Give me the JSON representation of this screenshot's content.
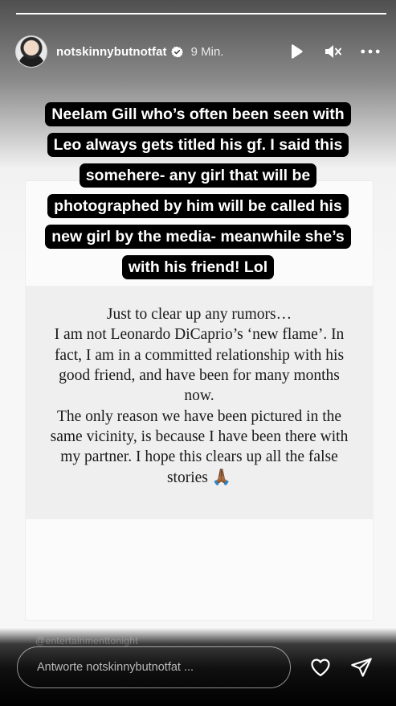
{
  "story": {
    "progress_fraction": 1.0,
    "username": "notskinnybutnotfat",
    "verified": true,
    "time_ago": "9 Min."
  },
  "controls": {
    "icons": [
      "play-icon",
      "muted-speaker-icon",
      "more-icon"
    ]
  },
  "caption_lines": [
    "Neelam Gill who’s often been seen with",
    "Leo always gets titled his gf. I said this",
    "somehere- any girl that will be",
    "photographed by him will be called his",
    "new girl by the media- meanwhile she’s",
    "with his friend! Lol"
  ],
  "statement": {
    "text": "Just to clear up any rumors…\nI am not Leonardo DiCaprio’s ‘new flame’. In fact, I am in a committed relationship with his good friend, and have been for many months now.\nThe only reason we have been pictured in the same vicinity, is because I have been there with my partner. I hope this clears up all the false stories 🙏🏾"
  },
  "watermark": "@entertainmenttonight",
  "reply": {
    "placeholder": "Antworte notskinnybutnotfat ..."
  },
  "colors": {
    "accent_white": "#ffffff",
    "sticker_bg": "#000000",
    "card_bg": "#efefef"
  }
}
